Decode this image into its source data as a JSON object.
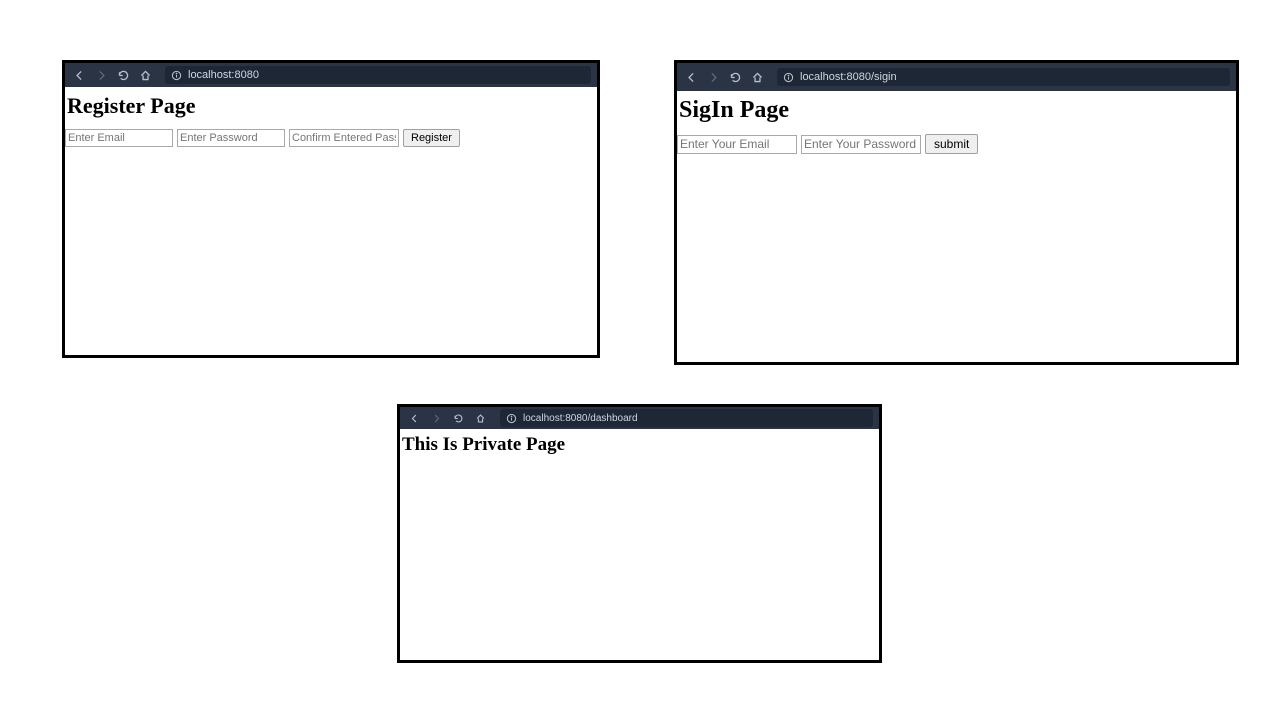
{
  "window1": {
    "url": "localhost:8080",
    "heading": "Register Page",
    "email_placeholder": "Enter Email",
    "password_placeholder": "Enter Password",
    "confirm_placeholder": "Confirm Entered Password",
    "button_label": "Register"
  },
  "window2": {
    "url": "localhost:8080/sigin",
    "heading": "SigIn Page",
    "email_placeholder": "Enter Your Email",
    "password_placeholder": "Enter Your Password",
    "button_label": "submit"
  },
  "window3": {
    "url": "localhost:8080/dashboard",
    "heading": "This Is Private Page"
  }
}
